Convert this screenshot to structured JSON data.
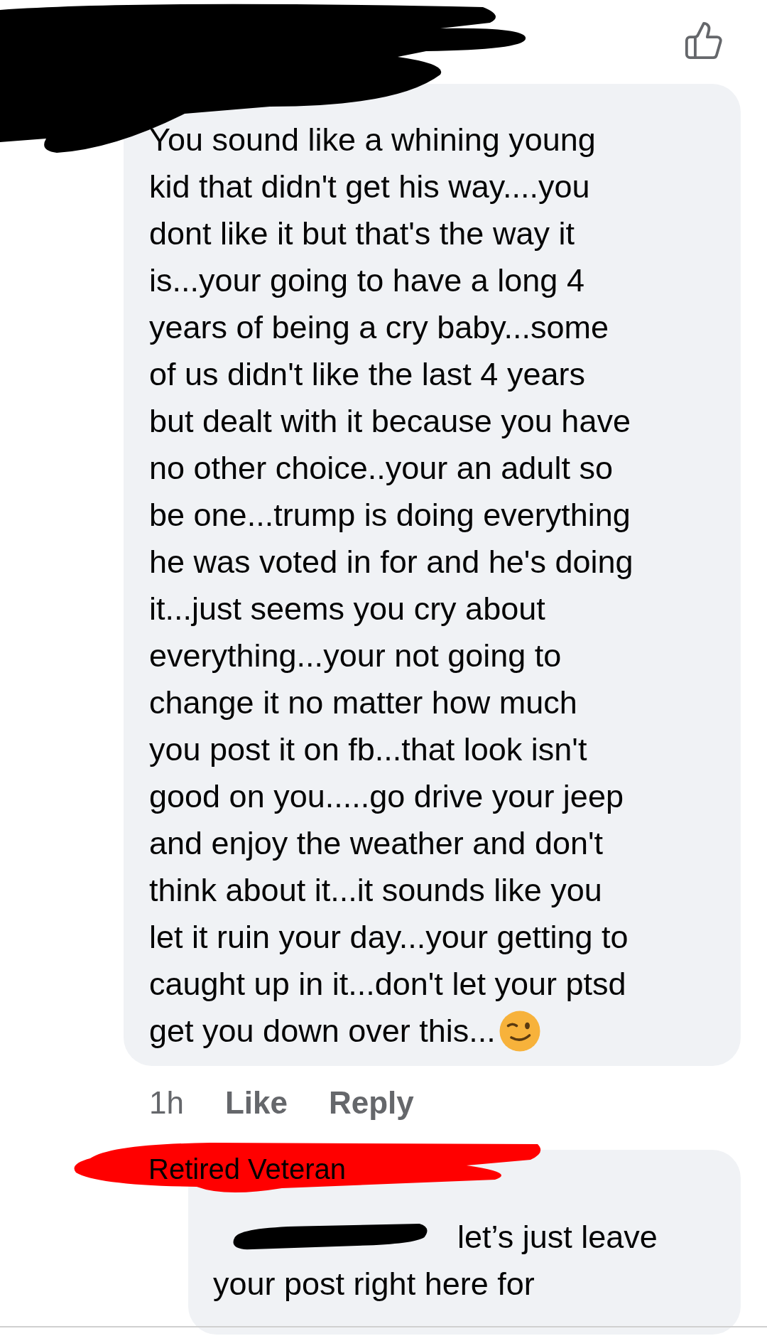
{
  "comment": {
    "lines": [
      "You sound like a whining young",
      "kid that didn't get his way....you",
      "dont like it but that's the way it",
      "is...your going to have a long 4",
      "years of being a cry baby...some",
      "of us didn't like the last 4 years",
      "but dealt with it because you have",
      "no other choice..your an adult so",
      "be one...trump is doing everything",
      "he was voted in for and he's doing",
      "it...just seems you cry about",
      "everything...your not going to",
      "change it no matter how much",
      "you post it on fb...that look isn't",
      "good on you.....go drive your jeep",
      "and enjoy the weather and don't",
      "think about it...it sounds like you",
      "let it ruin your day...your getting to",
      "caught up in it...don't let your ptsd",
      "get you down over this..."
    ],
    "time": "1h",
    "actions": [
      "Like",
      "Reply"
    ]
  },
  "annotation": "Retired Veteran",
  "reply": {
    "lines": [
      "let’s just leave",
      "your post right here for"
    ]
  }
}
